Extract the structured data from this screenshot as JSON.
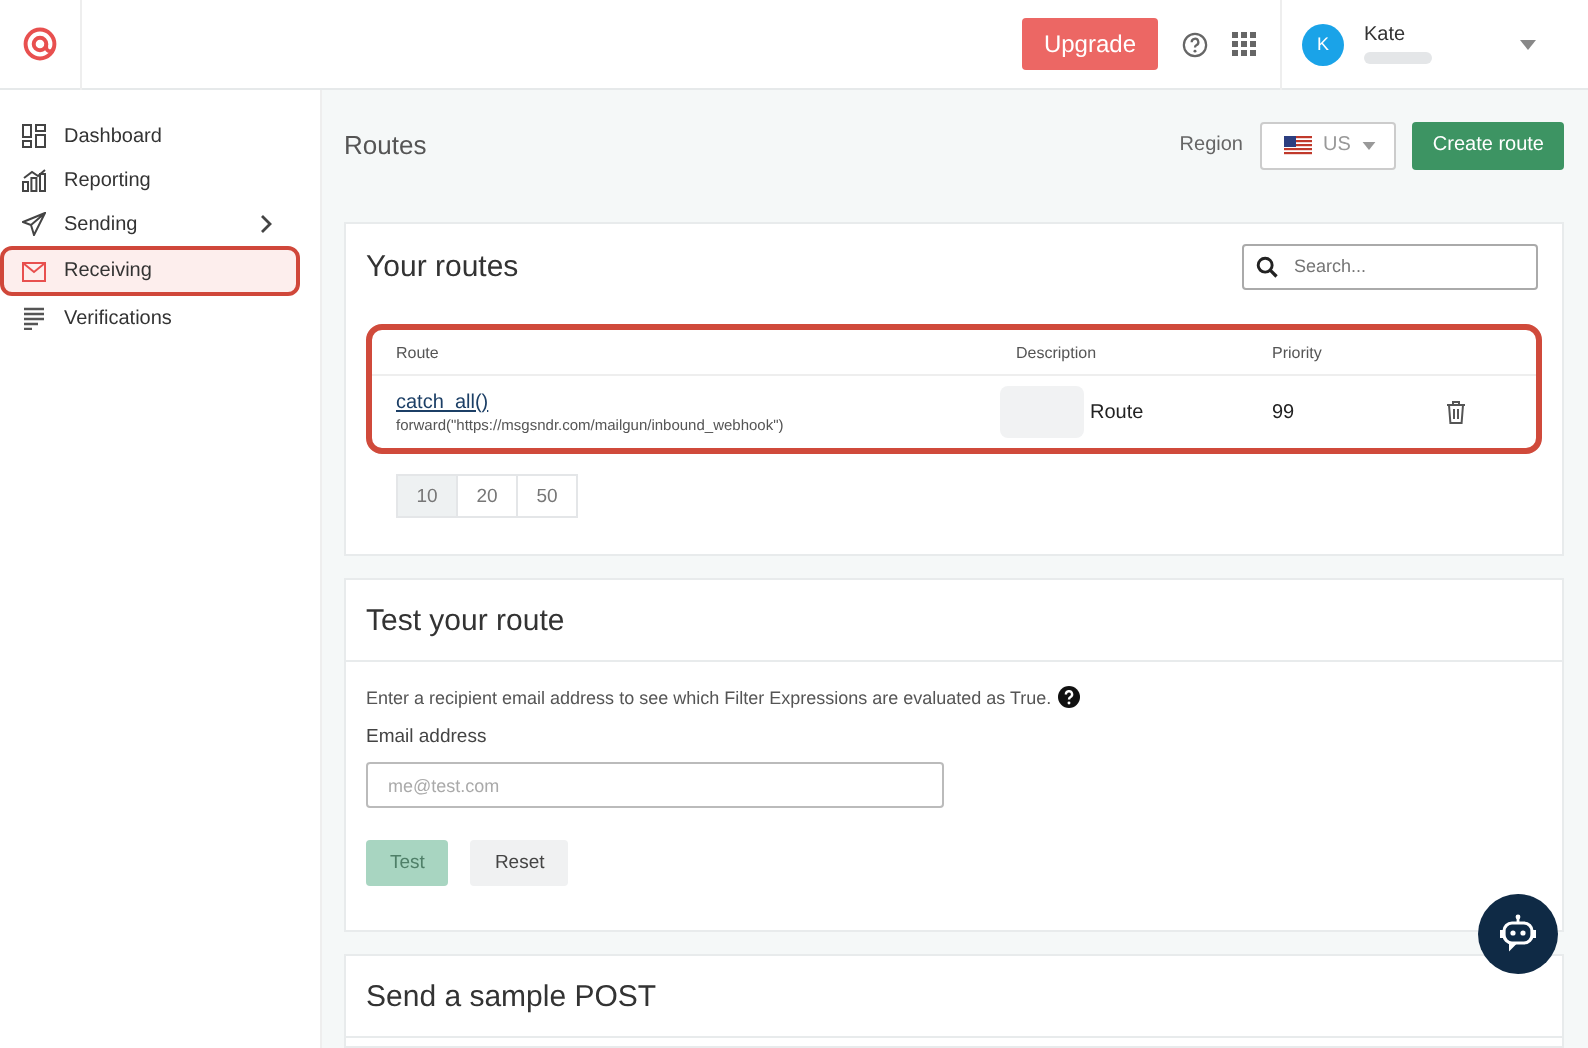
{
  "header": {
    "upgrade": "Upgrade",
    "user": {
      "initial": "K",
      "name": "Kate"
    }
  },
  "sidebar": {
    "items": [
      {
        "label": "Dashboard",
        "selected": false,
        "has_submenu": false
      },
      {
        "label": "Reporting",
        "selected": false,
        "has_submenu": false
      },
      {
        "label": "Sending",
        "selected": false,
        "has_submenu": true
      },
      {
        "label": "Receiving",
        "selected": true,
        "has_submenu": false
      },
      {
        "label": "Verifications",
        "selected": false,
        "has_submenu": false
      }
    ]
  },
  "page": {
    "title": "Routes",
    "region_label": "Region",
    "region": "US",
    "create": "Create route"
  },
  "routes": {
    "title": "Your routes",
    "search": {
      "placeholder": "Search..."
    },
    "columns": [
      "Route",
      "Description",
      "Priority"
    ],
    "rows": [
      {
        "expression": "catch_all()",
        "action": "forward(\"https://msgsndr.com/mailgun/inbound_webhook\")",
        "description": "Route",
        "priority": "99"
      }
    ],
    "page_sizes": [
      {
        "label": "10",
        "selected": true
      },
      {
        "label": "20",
        "selected": false
      },
      {
        "label": "50",
        "selected": false
      }
    ]
  },
  "test": {
    "title": "Test your route",
    "hint": "Enter a recipient email address to see which Filter Expressions are evaluated as True.",
    "field_label": "Email address",
    "placeholder": "me@test.com",
    "buttons": [
      {
        "label": "Test",
        "kind": "primary",
        "disabled": true
      },
      {
        "label": "Reset",
        "kind": "secondary",
        "disabled": false
      }
    ]
  },
  "sample": {
    "title": "Send a sample POST"
  }
}
